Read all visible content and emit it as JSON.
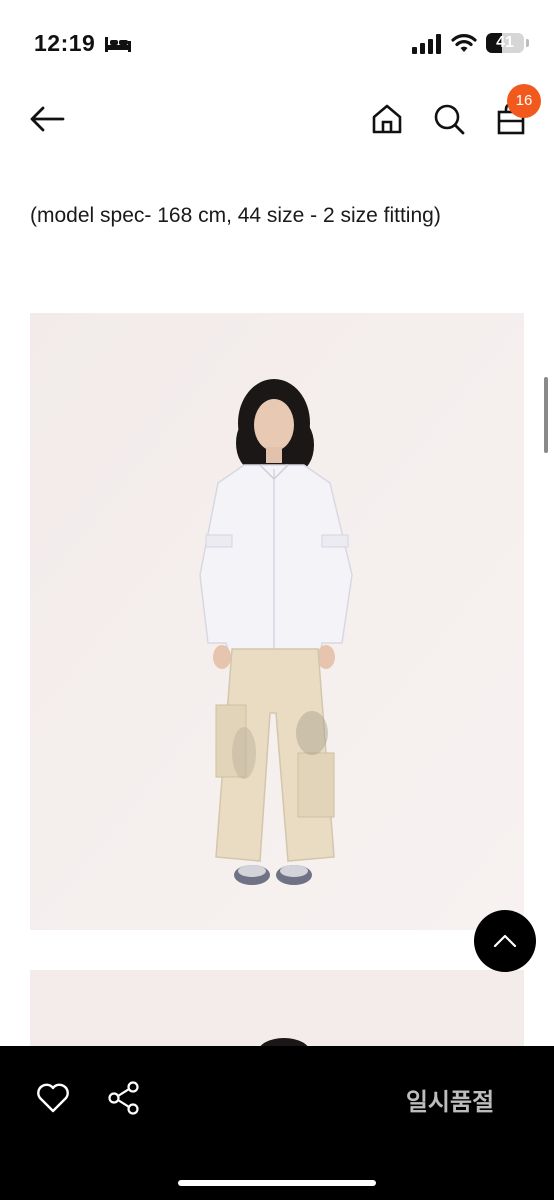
{
  "status_bar": {
    "time": "12:19",
    "sleep_icon": "bed-icon",
    "signal_icon": "cellular-signal-icon",
    "wifi_icon": "wifi-icon",
    "battery_level": "41"
  },
  "nav": {
    "back_icon": "arrow-left-icon",
    "home_icon": "home-icon",
    "search_icon": "search-icon",
    "cart_icon": "shopping-bag-icon",
    "cart_count": "16"
  },
  "content": {
    "model_spec": "(model spec- 168 cm, 44 size - 2 size fitting)"
  },
  "actions": {
    "wishlist_icon": "heart-icon",
    "share_icon": "share-icon",
    "status_label": "일시품절",
    "scroll_top_icon": "chevron-up-icon"
  },
  "colors": {
    "badge": "#f25a1d",
    "bottom_bar": "#000000",
    "status_label": "#bdbdbd"
  }
}
